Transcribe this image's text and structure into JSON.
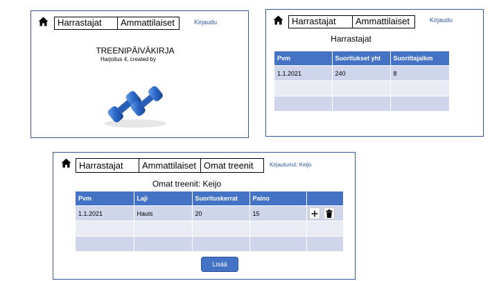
{
  "nav": {
    "harrastajat": "Harrastajat",
    "ammattilaiset": "Ammattilaiset",
    "omat_treenit": "Omat treenit"
  },
  "screen1": {
    "login_link": "Kirjaudu",
    "title": "TREENIPÄIVÄKIRJA",
    "subtitle": "Harjoitus 4, created by",
    "image": "blue-dumbbells"
  },
  "screen2": {
    "login_link": "Kirjaudu",
    "heading": "Harrastajat",
    "columns": [
      "Pvm",
      "Suoritukset yht",
      "Suorittajalkm"
    ],
    "rows": [
      [
        "1.1.2021",
        "240",
        "8"
      ],
      [
        "",
        "",
        ""
      ],
      [
        "",
        "",
        ""
      ]
    ]
  },
  "screen3": {
    "logged_in": "Kirjautunut: Keijo",
    "heading": "Omat treenit: Keijo",
    "columns": [
      "Pvm",
      "Laji",
      "Suorituskerrat",
      "Paino",
      ""
    ],
    "rows": [
      [
        "1.1.2021",
        "Hauis",
        "20",
        "15",
        ""
      ],
      [
        "",
        "",
        "",
        "",
        ""
      ],
      [
        "",
        "",
        "",
        "",
        ""
      ]
    ],
    "add_button": "Lisää",
    "row_actions": [
      "plus-icon",
      "trash-icon"
    ]
  },
  "colors": {
    "header": "#4472c4",
    "row_dark": "#cfd5ea",
    "row_light": "#e9ebf5",
    "border": "#2f5597",
    "link": "#2f5597"
  }
}
